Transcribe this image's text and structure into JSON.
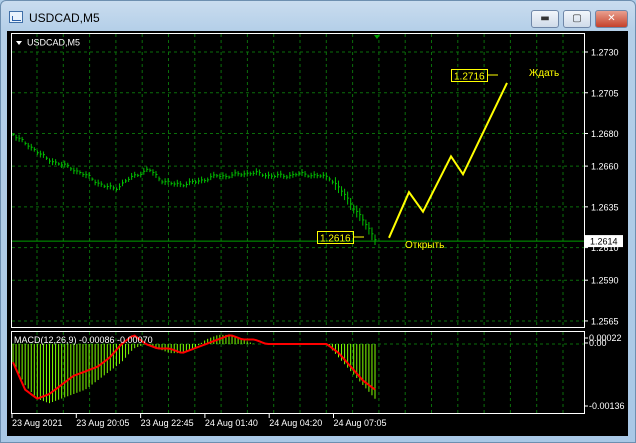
{
  "window": {
    "title": "USDCAD,M5",
    "minimize": "▬",
    "maximize": "▢",
    "close": "✕"
  },
  "chart": {
    "symbol_label": "USDCAD,M5",
    "price_ticks": [
      "1.2730",
      "1.2705",
      "1.2680",
      "1.2660",
      "1.2635",
      "1.2610",
      "1.2590",
      "1.2565"
    ],
    "current_price": "1.2614",
    "colors": {
      "bars": "#00c000",
      "grid": "#0a6e0a",
      "forecast": "#ffff00",
      "macd_hist": "#7fff00",
      "macd_signal": "#ff0000",
      "price_line": "#00a000"
    },
    "price_series": [
      1.268,
      1.2674,
      1.267,
      1.2664,
      1.2662,
      1.2659,
      1.2656,
      1.2652,
      1.2648,
      1.2646,
      1.2651,
      1.2655,
      1.2658,
      1.2652,
      1.2649,
      1.2649,
      1.265,
      1.2652,
      1.2654,
      1.2654,
      1.2655,
      1.2656,
      1.2655,
      1.2654,
      1.2654,
      1.2655,
      1.2655,
      1.2654,
      1.2653,
      1.2645,
      1.2636,
      1.2626,
      1.2616
    ],
    "forecast": {
      "points": [
        1.2616,
        1.2644,
        1.2632,
        1.2666,
        1.2655,
        1.2711
      ],
      "start_label": "1.2616",
      "end_label": "1.2716",
      "open_text": "Открыть",
      "wait_text": "Ждать"
    }
  },
  "macd": {
    "label": "MACD(12,26,9) -0.00086 -0.00070",
    "ticks": [
      "0.00022",
      "0.00",
      "-0.00136"
    ],
    "histogram": [
      -0.0004,
      -0.0009,
      -0.0012,
      -0.0013,
      -0.0012,
      -0.0011,
      -0.001,
      -0.0008,
      -0.0006,
      -0.0004,
      -0.0001,
      0.0,
      -0.0001,
      -0.0002,
      -0.0002,
      -0.0001,
      0.0001,
      0.0002,
      0.0002,
      0.0001,
      0.0,
      0.0,
      0.0,
      0.0,
      0.0,
      0.0,
      0.0,
      -0.0003,
      -0.0006,
      -0.0009,
      -0.0012
    ],
    "signal": [
      -0.0004,
      -0.001,
      -0.0012,
      -0.0011,
      -0.0009,
      -0.0007,
      -0.0006,
      -0.0005,
      -0.0003,
      0.0,
      0.0002,
      0.0,
      -0.0001,
      -0.0001,
      -0.0002,
      -0.0001,
      0.0,
      0.0001,
      0.0002,
      0.0001,
      0.0001,
      0.0,
      0.0,
      0.0,
      0.0,
      0.0,
      0.0,
      -0.0002,
      -0.0005,
      -0.0008,
      -0.001
    ]
  },
  "time_labels": [
    "23 Aug 2021",
    "23 Aug 20:05",
    "23 Aug 22:45",
    "24 Aug 01:40",
    "24 Aug 04:20",
    "24 Aug 07:05"
  ]
}
